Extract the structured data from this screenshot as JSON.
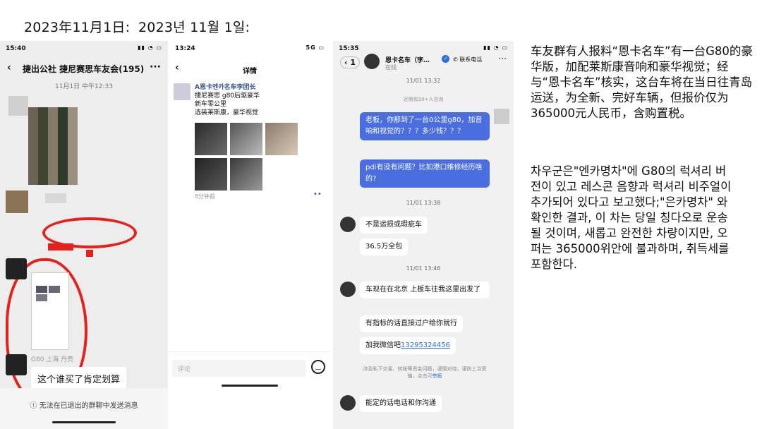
{
  "header": {
    "date_zh": "2023年11月1日:",
    "date_ko": "2023년 11월 1일:"
  },
  "phone1": {
    "time": "15:40",
    "status_icons": "▮▮ ◔ ▭",
    "title": "捷出公社 捷尼赛思车友会(195)",
    "timestamp": "11月1日 中午12:33",
    "sender_label": "G80 上海 丹亮",
    "message": "这个谁买了肯定划算",
    "footer": "无法在已退出的群聊中发送消息",
    "info_icon": "ⓘ"
  },
  "phone2": {
    "time": "13:24",
    "status_icons": "5G ▭",
    "title": "详情",
    "post_name": "A恩卡엔카名车李团长",
    "post_lines": [
      "捷尼赛思 g80后驱豪华",
      "新车零公里",
      "选装莱斯康，豪华视觉"
    ],
    "post_time": "8分钟前",
    "dots": "••",
    "comment_placeholder": "评论"
  },
  "phone3": {
    "time": "15:35",
    "status_icons": "▮▮ ◔ ▭",
    "back_count": "1",
    "name": "恩卡名车（李…",
    "status": "在线",
    "phone_btn": "联系电话",
    "ts1": "11/01 13:32",
    "consult": "近期有99+人咨询",
    "msg1": "老板，你那到了一台0公里g80，加音响和视觉的？？？多少钱？？？",
    "msg2": "pdi有没有问题？比如港口维修经历啥的?",
    "ts2": "11/01 13:38",
    "reply1": "不是运损或瑕疵车",
    "reply2": "36.5万全包",
    "ts3": "11/01 13:46",
    "reply3": "车现在在北京  上板车往我这里出发了",
    "reply4": "有指标的话直接过户给你就行",
    "reply5_prefix": "加我微信吧",
    "reply5_link": "13295324456",
    "notice": "涉及私下交易、转账等资金问题，谨慎对待，谨防上当受骗，点击可",
    "notice_link": "举报",
    "reply6": "能定的话电话和你沟通"
  },
  "text": {
    "zh": "车友群有人报料“恩卡名车”有一台G80的豪华版，加配莱斯康音响和豪华视觉；经与“恩卡名车”核实，这台车将在当日往青岛运送，为全新、完好车辆，但报价仅为365000元人民币，含购置税。",
    "ko": "차우군은\"엔카명차\"에 G80의 럭셔리 버전이 있고 레스콘 음향과 럭셔리 비주얼이 추가되어 있다고 보고했다;\"은카명차\" 와 확인한 결과, 이 차는 당일 칭다오로 운송될 것이며, 새롭고 완전한 차량이지만, 오퍼는 365000위안에 불과하며, 취득세를 포함한다."
  },
  "colors": {
    "annotation_red": "#e6201b",
    "bubble_blue": "#4a6ee0",
    "link_blue": "#2c6ee0"
  }
}
